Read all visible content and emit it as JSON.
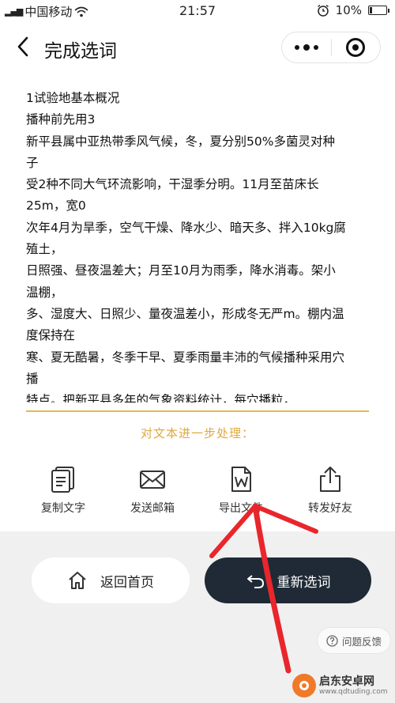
{
  "status_bar": {
    "carrier": "中国移动",
    "time": "21:57",
    "battery": "10%"
  },
  "nav": {
    "title": "完成选词"
  },
  "content": {
    "lines": [
      "1试验地基本概况",
      "播种前先用3",
      "新平县属中亚热带季风气候，冬，夏分别50%多菌灵对种",
      "子",
      "受2种不同大气环流影响，干湿季分明。11月至苗床长",
      "25m，宽0",
      "次年4月为旱季，空气干燥、降水少、暗天多、拌入10kg腐",
      "殖土，",
      "日照强、昼夜温差大；月至10月为雨季，降水消毒。架小",
      "温棚，",
      "多、湿度大、日照少、量夜温差小，形成冬无严m。棚内温",
      "度保持在",
      "寒、夏无酷暑，冬季干早、夏季雨量丰沛的气候播种采用穴",
      "播",
      "特点。把新平县多年的气象资料统计，每穴播粒，"
    ]
  },
  "process": {
    "label": "对文本进一步处理："
  },
  "actions": [
    {
      "label": "复制文字",
      "icon": "copy-text-icon"
    },
    {
      "label": "发送邮箱",
      "icon": "envelope-icon"
    },
    {
      "label": "导出文件",
      "icon": "word-document-icon"
    },
    {
      "label": "转发好友",
      "icon": "share-icon"
    }
  ],
  "buttons": {
    "home": "返回首页",
    "reselect": "重新选词"
  },
  "feedback": {
    "label": "问题反馈"
  },
  "watermark": {
    "name": "启东安卓网",
    "url": "www.qdtuding.com"
  },
  "colors": {
    "accent_gold": "#e0a93c",
    "dark_button": "#1f2a36",
    "annotation_red": "#e8262c"
  }
}
